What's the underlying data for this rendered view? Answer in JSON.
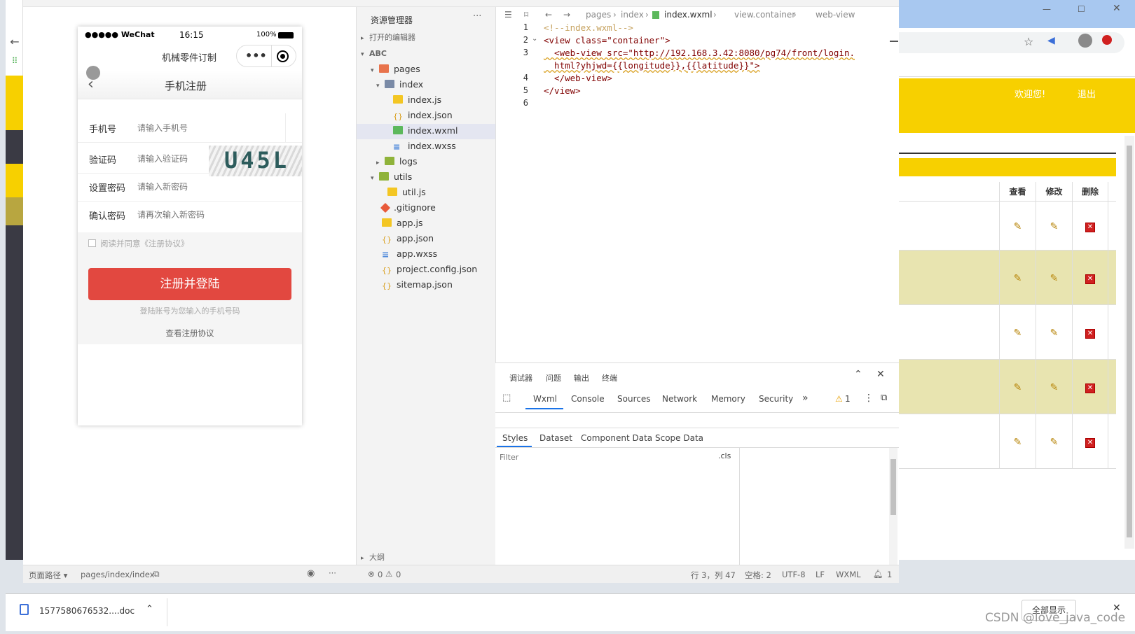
{
  "phone": {
    "carrier": "●●●●● WeChat",
    "time": "16:15",
    "battery": "100%",
    "app_title": "机械零件订制",
    "page_title": "手机注册",
    "form": [
      {
        "label": "手机号",
        "placeholder": "请输入手机号"
      },
      {
        "label": "验证码",
        "placeholder": "请输入验证码"
      },
      {
        "label": "设置密码",
        "placeholder": "请输入新密码"
      },
      {
        "label": "确认密码",
        "placeholder": "请再次输入新密码"
      }
    ],
    "captcha": "U45L",
    "agree": "阅读并同意《注册协议》",
    "submit": "注册并登陆",
    "hint": "登陆账号为您输入的手机号码",
    "view_agreement": "查看注册协议"
  },
  "explorer": {
    "title": "资源管理器",
    "more": "···",
    "open_editors": "打开的编辑器",
    "project": "ABC",
    "items": [
      {
        "name": "pages",
        "color": "#e8734c"
      },
      {
        "name": "index",
        "color": "#7a8aa6"
      },
      {
        "name": "index.js",
        "color": "#f3c623"
      },
      {
        "name": "index.json",
        "color": "#d9a020"
      },
      {
        "name": "index.wxml",
        "color": "#5cb85c"
      },
      {
        "name": "index.wxss",
        "color": "#3b7dd8"
      },
      {
        "name": "logs",
        "color": "#8fb33a"
      },
      {
        "name": "utils",
        "color": "#8fb33a"
      },
      {
        "name": "util.js",
        "color": "#f3c623"
      },
      {
        "name": ".gitignore",
        "color": "#e85a3a"
      },
      {
        "name": "app.js",
        "color": "#f3c623"
      },
      {
        "name": "app.json",
        "color": "#d9a020"
      },
      {
        "name": "app.wxss",
        "color": "#3b7dd8"
      },
      {
        "name": "project.config.json",
        "color": "#d9a020"
      },
      {
        "name": "sitemap.json",
        "color": "#d9a020"
      }
    ],
    "outline": "大纲"
  },
  "editor": {
    "breadcrumb": [
      "pages",
      "index",
      "index.wxml",
      "view.container",
      "web-view"
    ],
    "line_numbers": [
      "1",
      "2",
      "3",
      "",
      "4",
      "5",
      "6"
    ],
    "lines": [
      "<!--index.wxml-->",
      "<view class=\"container\">",
      "  <web-view src=\"http://192.168.3.42:8080/pg74/front/login.",
      "  html?yhjwd={{longitude}},{{latitude}}\">",
      "  </web-view>",
      "</view>",
      ""
    ]
  },
  "debugger": {
    "top_tabs": [
      "调试器",
      "问题",
      "输出",
      "终端"
    ],
    "tabs": [
      "Wxml",
      "Console",
      "Sources",
      "Network",
      "Memory",
      "Security"
    ],
    "more": "»",
    "warnings": "1",
    "style_tabs": [
      "Styles",
      "Dataset",
      "Component Data",
      "Scope Data"
    ],
    "filter_placeholder": "Filter",
    "cls": ".cls"
  },
  "status": {
    "path_label": "页面路径 ▾",
    "path": "pages/index/index",
    "errors": "0",
    "warnings": "0",
    "position": "行 3，列 47",
    "spaces": "空格: 2",
    "encoding": "UTF-8",
    "eol": "LF",
    "lang": "WXML",
    "notif": "1"
  },
  "web": {
    "welcome": "欢迎您!",
    "logout": "退出",
    "headers": [
      "查看",
      "修改",
      "删除"
    ],
    "rows": 5
  },
  "download": {
    "file": "1577580676532....doc",
    "show_all": "全部显示"
  },
  "watermark": "CSDN @love_java_code"
}
